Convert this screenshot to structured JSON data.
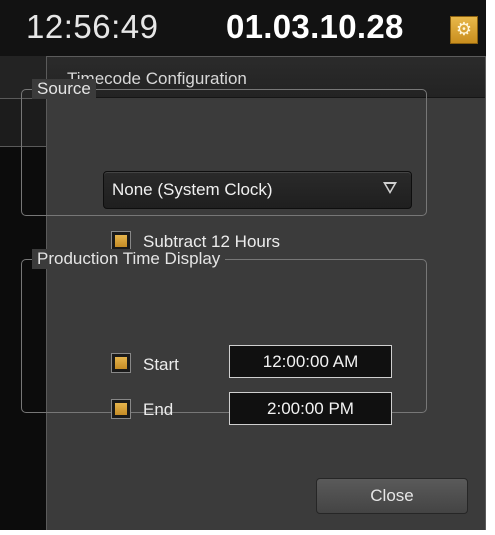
{
  "clock": {
    "time": "12:56:49",
    "timecode": "01.03.10.28",
    "settings_icon": "gear-icon",
    "settings_glyph": "⚙"
  },
  "dialog": {
    "title": "Timecode Configuration",
    "source": {
      "legend": "Source",
      "dropdown_value": "None (System Clock)",
      "subtract_label": "Subtract 12 Hours",
      "subtract_checked": true
    },
    "production": {
      "legend": "Production Time Display",
      "start_label": "Start",
      "start_value": "12:00:00 AM",
      "start_checked": true,
      "end_label": "End",
      "end_value": "2:00:00 PM",
      "end_checked": true
    },
    "close_label": "Close"
  },
  "colors": {
    "accent": "#d9a23a",
    "dialog_bg": "#3b3b3b",
    "header_bg": "#262626",
    "text": "#e6e6e6"
  }
}
